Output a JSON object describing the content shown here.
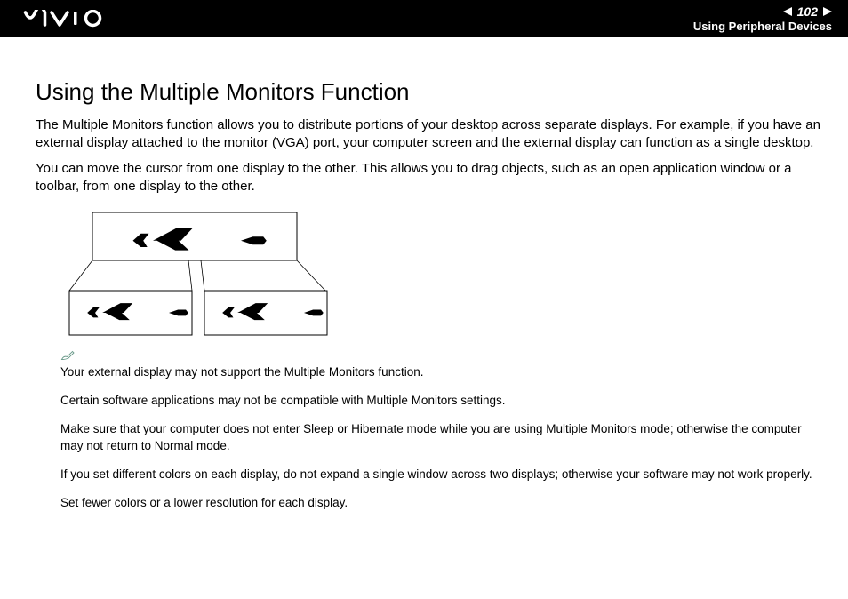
{
  "header": {
    "page_number": "102",
    "section": "Using Peripheral Devices"
  },
  "body": {
    "title": "Using the Multiple Monitors Function",
    "p1": "The Multiple Monitors function allows you to distribute portions of your desktop across separate displays. For example, if you have an external display attached to the monitor (VGA) port, your computer screen and the external display can function as a single desktop.",
    "p2": "You can move the cursor from one display to the other. This allows you to drag objects, such as an open application window or a toolbar, from one display to the other."
  },
  "notes": {
    "n1": "Your external display may not support the Multiple Monitors function.",
    "n2": "Certain software applications may not be compatible with Multiple Monitors settings.",
    "n3": "Make sure that your computer does not enter Sleep or Hibernate mode while you are using Multiple Monitors mode; otherwise the computer may not return to Normal mode.",
    "n4": "If you set different colors on each display, do not expand a single window across two displays; otherwise your software may not work properly.",
    "n5": "Set fewer colors or a lower resolution for each display."
  }
}
